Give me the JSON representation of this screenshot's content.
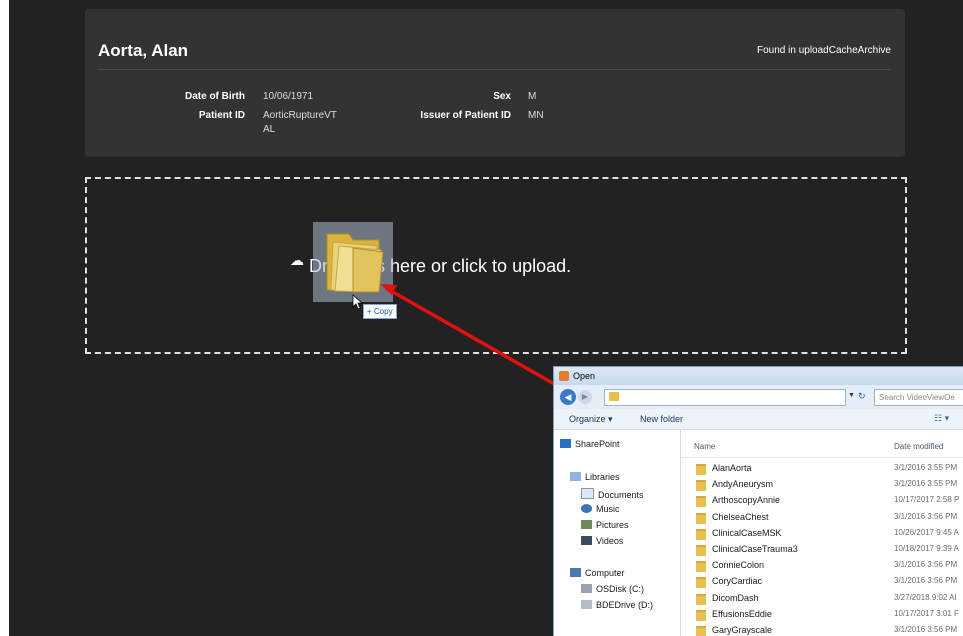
{
  "patient": {
    "name": "Aorta, Alan",
    "found_in": "Found in uploadCacheArchive",
    "fields": {
      "dob_label": "Date of Birth",
      "dob_value": "10/06/1971",
      "sex_label": "Sex",
      "sex_value": "M",
      "patient_id_label": "Patient ID",
      "patient_id_value_line1": "AorticRuptureVT",
      "patient_id_value_line2": "AL",
      "issuer_label": "Issuer of Patient ID",
      "issuer_value": "MN"
    }
  },
  "dropzone": {
    "text": "Drop files here or click to upload.",
    "copy_badge": "+ Copy"
  },
  "open_dialog": {
    "title": "Open",
    "search_placeholder": "Search VideoViewOe",
    "toolbar": {
      "organize": "Organize ▾",
      "new_folder": "New folder",
      "view": "☷ ▾"
    },
    "nav": {
      "sharepoint": "SharePoint",
      "libraries": "Libraries",
      "documents": "Documents",
      "music": "Music",
      "pictures": "Pictures",
      "videos": "Videos",
      "computer": "Computer",
      "osdisk": "OSDisk (C:)",
      "bdedrive": "BDEDrive (D:)"
    },
    "columns": {
      "name": "Name",
      "date_modified": "Date modified"
    },
    "files": [
      {
        "name": "AlanAorta",
        "date": "3/1/2016 3:55 PM"
      },
      {
        "name": "AndyAneurysm",
        "date": "3/1/2016 3:55 PM"
      },
      {
        "name": "ArthoscopyAnnie",
        "date": "10/17/2017 2:58 P"
      },
      {
        "name": "ChelseaChest",
        "date": "3/1/2016 3:56 PM"
      },
      {
        "name": "ClinicalCaseMSK",
        "date": "10/26/2017 9:45 A"
      },
      {
        "name": "ClinicalCaseTrauma3",
        "date": "10/18/2017 9:39 A"
      },
      {
        "name": "ConnieColon",
        "date": "3/1/2016 3:56 PM"
      },
      {
        "name": "CoryCardiac",
        "date": "3/1/2016 3:56 PM"
      },
      {
        "name": "DicomDash",
        "date": "3/27/2018 9:02 AI"
      },
      {
        "name": "EffusionsEddie",
        "date": "10/17/2017 3:01 F"
      },
      {
        "name": "GaryGrayscale",
        "date": "3/1/2016 3:56 PM"
      }
    ]
  },
  "colors": {
    "background": "#222222",
    "card": "#333333",
    "arrow": "#e01010",
    "folder": "#e7c052"
  }
}
